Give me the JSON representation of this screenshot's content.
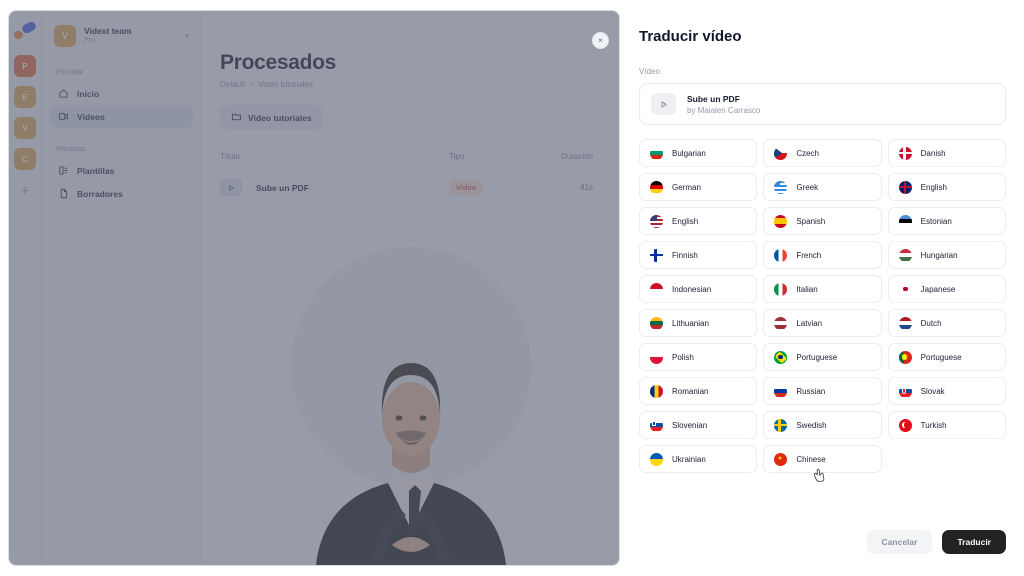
{
  "app": {
    "rail": {
      "logo": "vidext-logo",
      "add_label": "+",
      "avatars": [
        {
          "initial": "P",
          "color": "#e2653c",
          "name": "workspace-avatar-p"
        },
        {
          "initial": "E",
          "color": "#dda24f",
          "name": "workspace-avatar-e"
        },
        {
          "initial": "V",
          "color": "#dda24f",
          "name": "workspace-avatar-v"
        },
        {
          "initial": "C",
          "color": "#dda24f",
          "name": "workspace-avatar-c"
        }
      ]
    },
    "team": {
      "avatar_initial": "V",
      "name": "Vidext team",
      "plan": "Pro"
    },
    "nav": {
      "section_main": "Principal",
      "section_resources": "Recursos",
      "items_main": [
        {
          "label": "Inicio",
          "icon": "home-icon",
          "active": false
        },
        {
          "label": "Vídeos",
          "icon": "video-icon",
          "active": true
        }
      ],
      "items_resources": [
        {
          "label": "Plantillas",
          "icon": "template-icon",
          "active": false
        },
        {
          "label": "Borradores",
          "icon": "draft-icon",
          "active": false
        }
      ]
    },
    "content": {
      "title": "Procesados",
      "breadcrumb": [
        "Default",
        "Video tutoriales"
      ],
      "breadcrumb_separator": "›",
      "folder_chip": "Video tutoriales",
      "table": {
        "headers": {
          "title": "Título",
          "type": "Tipo",
          "duration": "Duración"
        },
        "rows": [
          {
            "title": "Sube un PDF",
            "type": "Video",
            "duration": "41s"
          }
        ]
      }
    },
    "close_label": "×"
  },
  "panel": {
    "title": "Traducir vídeo",
    "video_field_label": "Vídeo",
    "video": {
      "title": "Sube un PDF",
      "author": "by Maialen Carrasco"
    },
    "languages": [
      {
        "label": "Bulgarian",
        "flag": "bg"
      },
      {
        "label": "Czech",
        "flag": "cz"
      },
      {
        "label": "Danish",
        "flag": "dk"
      },
      {
        "label": "German",
        "flag": "de"
      },
      {
        "label": "Greek",
        "flag": "gr"
      },
      {
        "label": "English",
        "flag": "gb"
      },
      {
        "label": "English",
        "flag": "us"
      },
      {
        "label": "Spanish",
        "flag": "es"
      },
      {
        "label": "Estonian",
        "flag": "ee"
      },
      {
        "label": "Finnish",
        "flag": "fi"
      },
      {
        "label": "French",
        "flag": "fr"
      },
      {
        "label": "Hungarian",
        "flag": "hu"
      },
      {
        "label": "Indonesian",
        "flag": "id"
      },
      {
        "label": "Italian",
        "flag": "it"
      },
      {
        "label": "Japanese",
        "flag": "jp"
      },
      {
        "label": "Lithuanian",
        "flag": "lt"
      },
      {
        "label": "Latvian",
        "flag": "lv"
      },
      {
        "label": "Dutch",
        "flag": "nl"
      },
      {
        "label": "Polish",
        "flag": "pl"
      },
      {
        "label": "Portuguese",
        "flag": "br"
      },
      {
        "label": "Portuguese",
        "flag": "pt"
      },
      {
        "label": "Romanian",
        "flag": "ro"
      },
      {
        "label": "Russian",
        "flag": "ru"
      },
      {
        "label": "Slovak",
        "flag": "sk"
      },
      {
        "label": "Slovenian",
        "flag": "si"
      },
      {
        "label": "Swedish",
        "flag": "se"
      },
      {
        "label": "Turkish",
        "flag": "tr"
      },
      {
        "label": "Ukrainian",
        "flag": "ua"
      },
      {
        "label": "Chinese",
        "flag": "cn"
      }
    ],
    "cancel_label": "Cancelar",
    "submit_label": "Traducir"
  },
  "colors": {
    "accent_dark": "#222222",
    "badge_bg": "#f6dcd6",
    "badge_text": "#d0654a",
    "avatar_orange": "#e2653c",
    "avatar_gold": "#dda24f"
  }
}
